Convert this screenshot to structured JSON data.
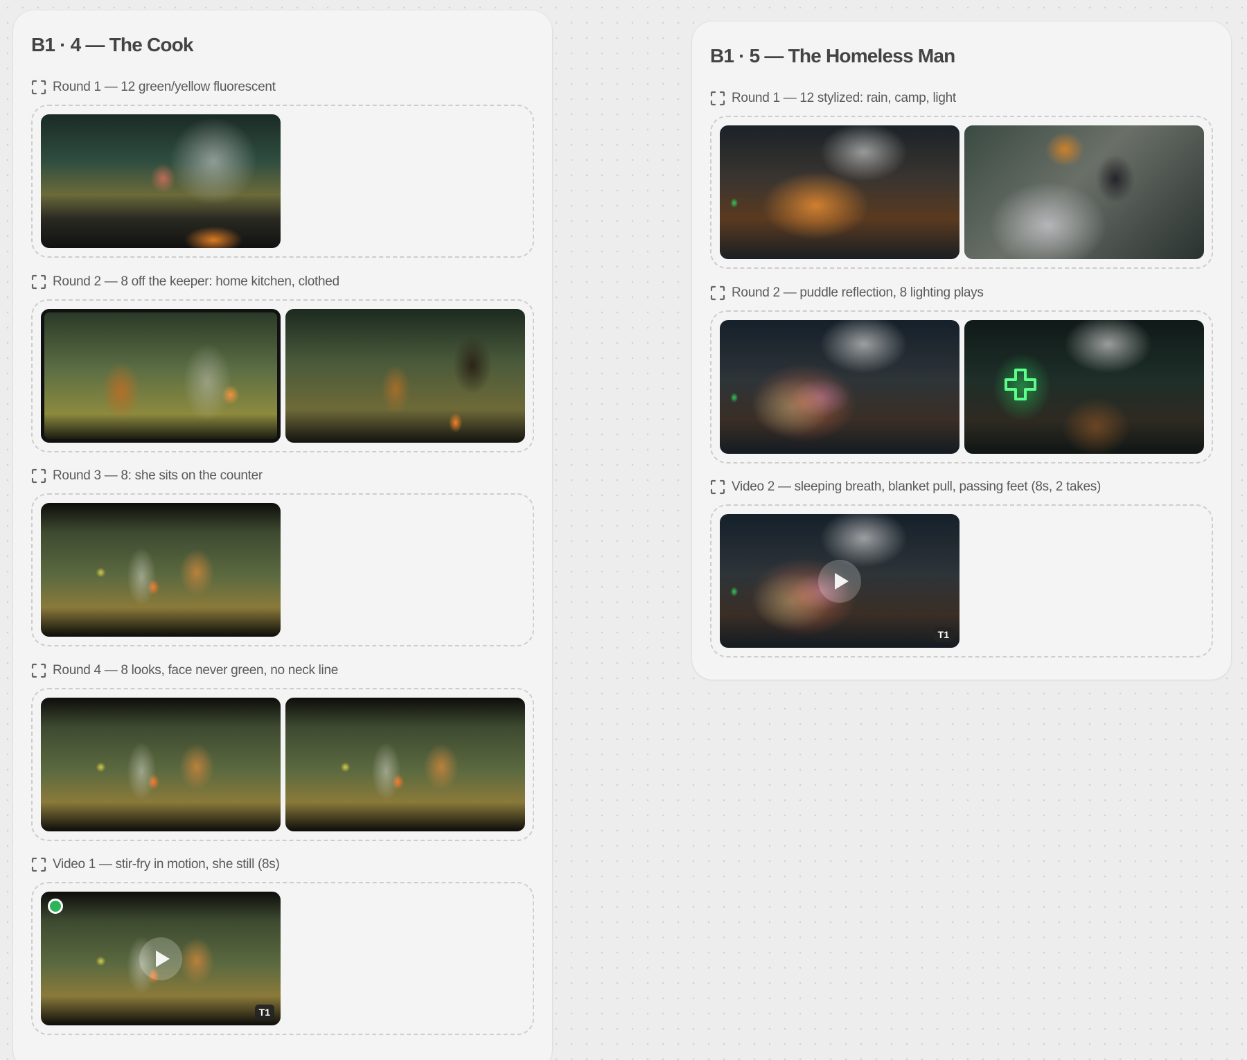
{
  "boards": [
    {
      "title": "B1 · 4 — The Cook",
      "groups": [
        {
          "label": "Round 1 — 12 green/yellow fluorescent",
          "items": [
            {
              "kind": "image",
              "badge": ""
            }
          ]
        },
        {
          "label": "Round 2 — 8 off the keeper: home kitchen, clothed",
          "items": [
            {
              "kind": "image",
              "badge": ""
            },
            {
              "kind": "image",
              "badge": ""
            }
          ]
        },
        {
          "label": "Round 3 — 8: she sits on the counter",
          "items": [
            {
              "kind": "image",
              "badge": ""
            }
          ]
        },
        {
          "label": "Round 4 — 8 looks, face never green, no neck line",
          "items": [
            {
              "kind": "image",
              "badge": ""
            },
            {
              "kind": "image",
              "badge": ""
            }
          ]
        },
        {
          "label": "Video 1 — stir-fry in motion, she still (8s)",
          "items": [
            {
              "kind": "video",
              "badge": "T1",
              "status": "active"
            }
          ]
        }
      ]
    },
    {
      "title": "B1 · 5 — The Homeless Man",
      "groups": [
        {
          "label": "Round 1 — 12 stylized: rain, camp, light",
          "items": [
            {
              "kind": "image",
              "badge": ""
            },
            {
              "kind": "image",
              "badge": ""
            }
          ]
        },
        {
          "label": "Round 2 — puddle reflection, 8 lighting plays",
          "items": [
            {
              "kind": "image",
              "badge": ""
            },
            {
              "kind": "image",
              "badge": ""
            }
          ]
        },
        {
          "label": "Video 2 — sleeping breath, blanket pull, passing feet (8s, 2 takes)",
          "items": [
            {
              "kind": "video",
              "badge": "T1"
            }
          ]
        }
      ]
    }
  ],
  "colors": {
    "canvas": "#ededed",
    "card": "#f4f4f4",
    "status_dot": "#2db45a",
    "badge_bg": "#232323"
  },
  "icons": {
    "group": "frame-corners-icon",
    "video": "play-icon"
  }
}
